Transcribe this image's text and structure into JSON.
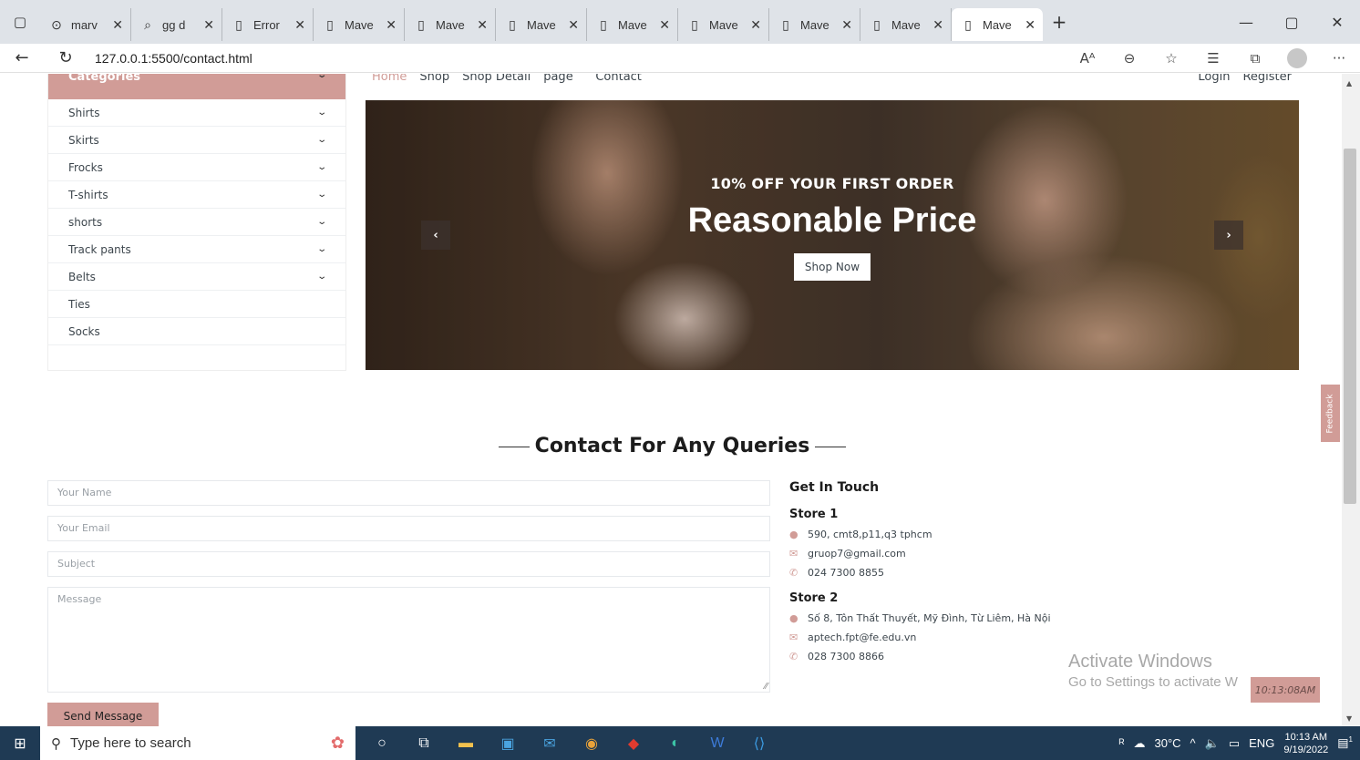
{
  "browser": {
    "tabs": [
      {
        "icon": "github-icon",
        "glyph": "⊙",
        "label": "marv"
      },
      {
        "icon": "search-icon",
        "glyph": "⌕",
        "label": "gg d"
      },
      {
        "icon": "page-icon",
        "glyph": "▯",
        "label": "Error"
      },
      {
        "icon": "page-icon",
        "glyph": "▯",
        "label": "Mave"
      },
      {
        "icon": "page-icon",
        "glyph": "▯",
        "label": "Mave"
      },
      {
        "icon": "page-icon",
        "glyph": "▯",
        "label": "Mave"
      },
      {
        "icon": "page-icon",
        "glyph": "▯",
        "label": "Mave"
      },
      {
        "icon": "page-icon",
        "glyph": "▯",
        "label": "Mave"
      },
      {
        "icon": "page-icon",
        "glyph": "▯",
        "label": "Mave"
      },
      {
        "icon": "page-icon",
        "glyph": "▯",
        "label": "Mave"
      },
      {
        "icon": "page-icon",
        "glyph": "▯",
        "label": "Mave",
        "active": true
      }
    ],
    "url": "127.0.0.1:5500/contact.html"
  },
  "sidebar": {
    "header": "Categories",
    "items": [
      {
        "label": "Shirts",
        "chevron": true
      },
      {
        "label": "Skirts",
        "chevron": true
      },
      {
        "label": "Frocks",
        "chevron": true
      },
      {
        "label": "T-shirts",
        "chevron": true
      },
      {
        "label": "shorts",
        "chevron": true
      },
      {
        "label": "Track pants",
        "chevron": true
      },
      {
        "label": "Belts",
        "chevron": true
      },
      {
        "label": "Ties",
        "chevron": false
      },
      {
        "label": "Socks",
        "chevron": false
      }
    ]
  },
  "topnav": {
    "links": [
      "Home",
      "Shop",
      "Shop Detail",
      "page ˅",
      "Contact"
    ],
    "right": [
      "Login",
      "Register"
    ]
  },
  "hero": {
    "subtitle": "10% OFF YOUR FIRST ORDER",
    "title": "Reasonable Price",
    "button": "Shop Now"
  },
  "contact": {
    "section_title": "Contact For Any Queries",
    "placeholders": {
      "name": "Your Name",
      "email": "Your Email",
      "subject": "Subject",
      "message": "Message"
    },
    "send": "Send Message",
    "get_in_touch": "Get In Touch",
    "stores": [
      {
        "name": "Store 1",
        "address": "590, cmt8,p11,q3 tphcm",
        "email": "gruop7@gmail.com",
        "phone": "024 7300 8855"
      },
      {
        "name": "Store 2",
        "address": "Số 8, Tôn Thất Thuyết, Mỹ Đình, Từ Liêm, Hà Nội",
        "email": "aptech.fpt@fe.edu.vn",
        "phone": "028 7300 8866"
      }
    ]
  },
  "overlay": {
    "activate_title": "Activate Windows",
    "activate_sub": "Go to Settings to activate W",
    "clock_badge": "10:13:08AM",
    "feedback": "Feedback"
  },
  "taskbar": {
    "search_placeholder": "Type here to search",
    "weather": "30°C",
    "lang": "ENG",
    "time": "10:13 AM",
    "date": "9/19/2022",
    "notifications": "1"
  },
  "colors": {
    "accent": "#d19c97",
    "taskbar": "#1f3a54"
  }
}
